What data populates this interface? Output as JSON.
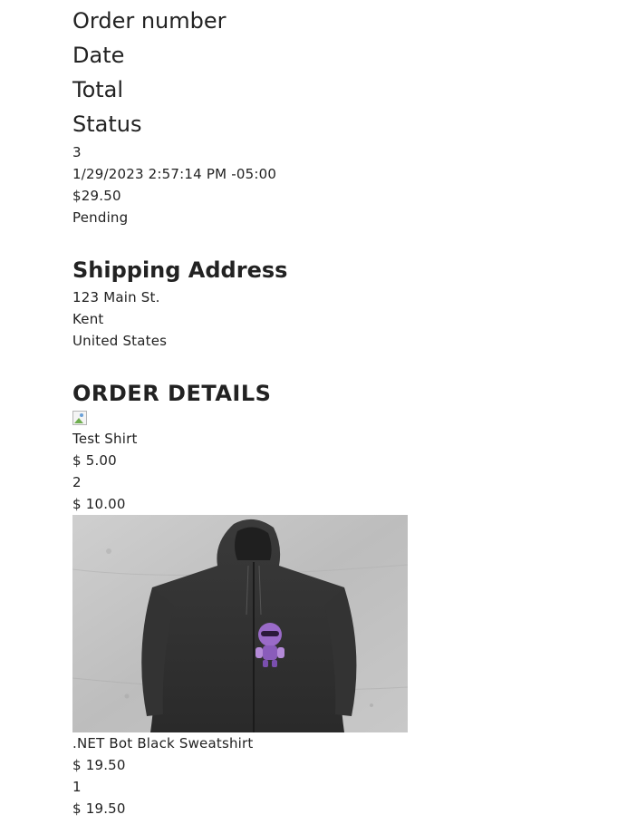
{
  "summary": {
    "order_number_label": "Order number",
    "date_label": "Date",
    "total_label": "Total",
    "status_label": "Status",
    "order_number": "3",
    "date": "1/29/2023 2:57:14 PM -05:00",
    "total": "$29.50",
    "status": "Pending"
  },
  "shipping": {
    "title": "Shipping Address",
    "street": "123 Main St.",
    "city": "Kent",
    "country": "United States"
  },
  "details": {
    "title": "ORDER DETAILS",
    "items": [
      {
        "name": "Test Shirt",
        "unit_price": "$ 5.00",
        "quantity": "2",
        "line_total": "$ 10.00",
        "image": "broken-image-icon"
      },
      {
        "name": ".NET Bot Black Sweatshirt",
        "unit_price": "$ 19.50",
        "quantity": "1",
        "line_total": "$ 19.50",
        "image": "black-hoodie-with-purple-bot-logo"
      }
    ]
  }
}
